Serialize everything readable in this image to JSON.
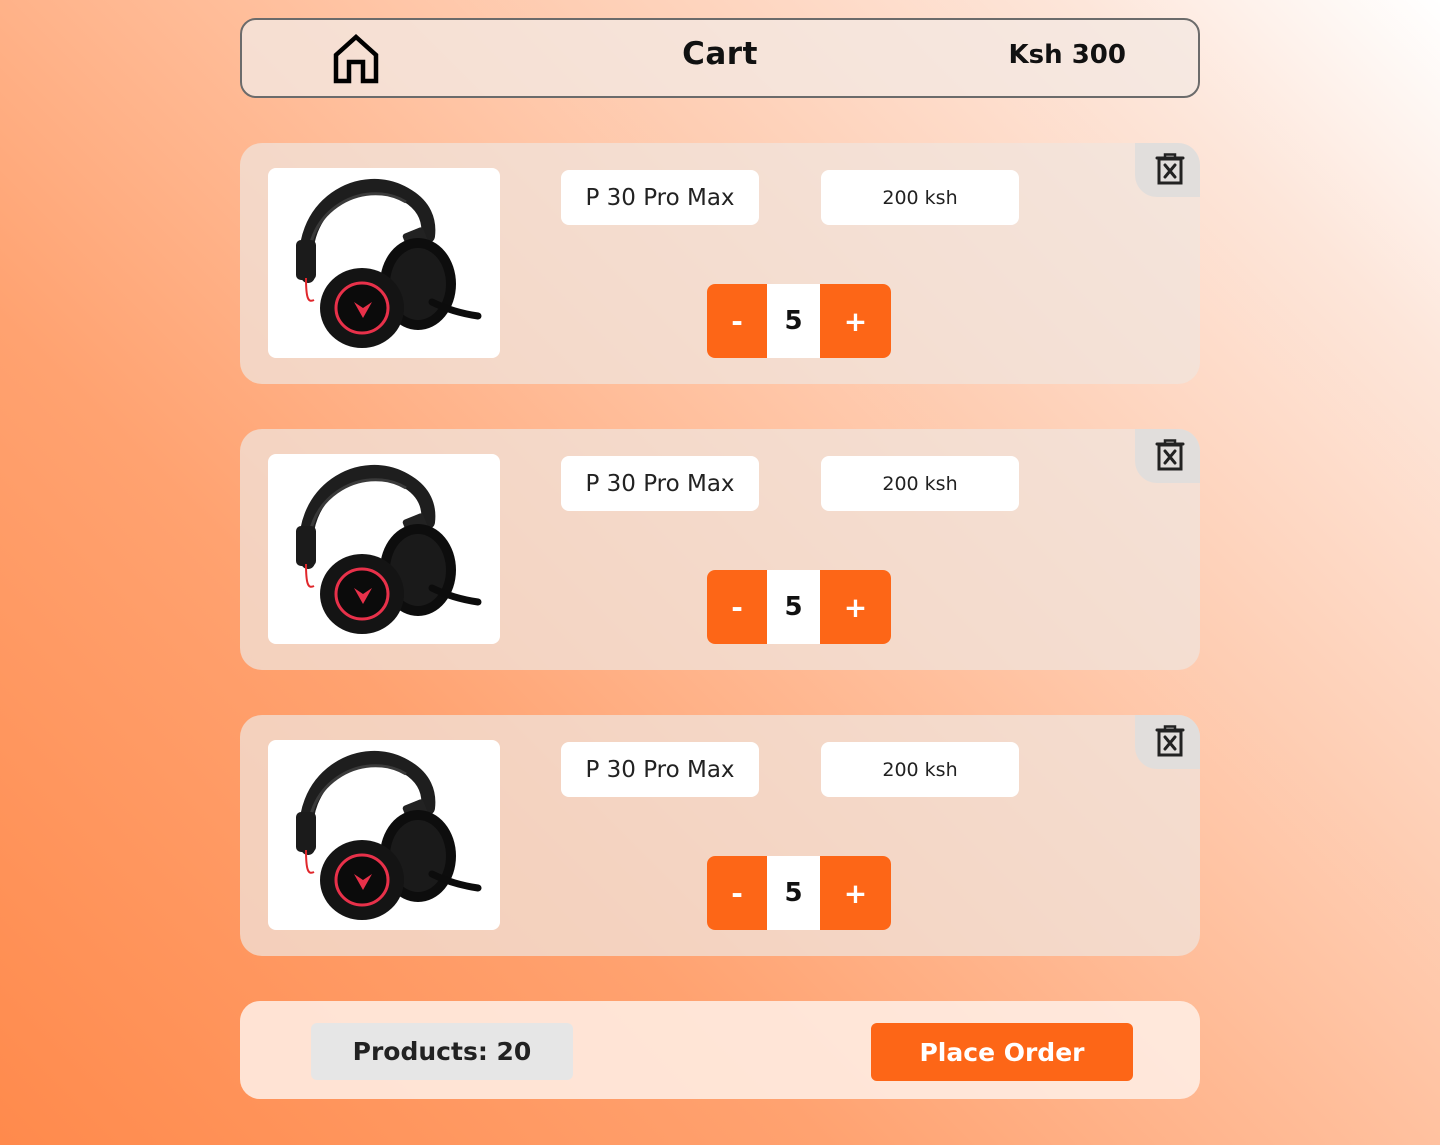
{
  "header": {
    "home_icon": "home-icon",
    "title": "Cart",
    "total": "Ksh 300"
  },
  "cart": {
    "items": [
      {
        "name": "P 30 Pro Max",
        "price": "200 ksh",
        "quantity": "5",
        "decrement_label": "-",
        "increment_label": "+",
        "image": "headphones-image",
        "delete_icon": "delete-icon"
      },
      {
        "name": "P 30 Pro Max",
        "price": "200 ksh",
        "quantity": "5",
        "decrement_label": "-",
        "increment_label": "+",
        "image": "headphones-image",
        "delete_icon": "delete-icon"
      },
      {
        "name": "P 30 Pro Max",
        "price": "200 ksh",
        "quantity": "5",
        "decrement_label": "-",
        "increment_label": "+",
        "image": "headphones-image",
        "delete_icon": "delete-icon"
      }
    ]
  },
  "footer": {
    "products_count": "Products: 20",
    "place_order_label": "Place Order"
  },
  "colors": {
    "accent": "#fd6617",
    "card_background": "#f0e4de",
    "delete_tab": "#e1dedc",
    "count_background": "#e6e6e6"
  }
}
